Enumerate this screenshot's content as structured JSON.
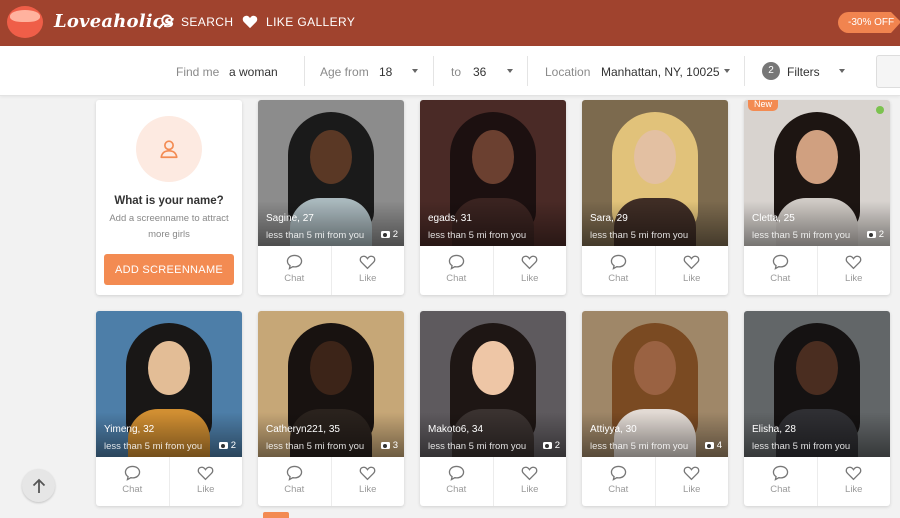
{
  "header": {
    "logo_text": "Loveaholics",
    "nav_search": "SEARCH",
    "nav_like_gallery": "LIKE GALLERY",
    "promo": "-30% OFF"
  },
  "filters": {
    "find_me_label": "Find me",
    "find_me_value": "a woman",
    "age_from_label": "Age from",
    "age_from_value": "18",
    "age_to_label": "to",
    "age_to_value": "36",
    "location_label": "Location",
    "location_value": "Manhattan, NY, 10025",
    "filters_count": "2",
    "filters_label": "Filters"
  },
  "prompt": {
    "title": "What is your name?",
    "subtitle": "Add a screenname to attract more girls",
    "button": "ADD SCREENNAME"
  },
  "action_labels": {
    "chat": "Chat",
    "like": "Like"
  },
  "profiles": [
    {
      "name": "Sagine, 27",
      "distance": "less than 5 mi from you",
      "photos": "2",
      "new": false,
      "online": false,
      "bg": "#8c8c8c",
      "hair": "#1a1a1a",
      "skin": "#5a3825",
      "top": "#a9b8bd"
    },
    {
      "name": "egads, 31",
      "distance": "less than 5 mi from you",
      "photos": "",
      "new": false,
      "online": false,
      "bg": "#4a2a26",
      "hair": "#1c1010",
      "skin": "#6b4030",
      "top": "#3a2320"
    },
    {
      "name": "Sara, 29",
      "distance": "less than 5 mi from you",
      "photos": "",
      "new": false,
      "online": false,
      "bg": "#7c6a4e",
      "hair": "#e1c27a",
      "skin": "#e3c0a2",
      "top": "#3f2d25"
    },
    {
      "name": "Cletta, 25",
      "distance": "less than 5 mi from you",
      "photos": "2",
      "new": true,
      "new_label": "New",
      "online": true,
      "bg": "#d8d3cf",
      "hair": "#1d1512",
      "skin": "#d0a080",
      "top": "#cfcac5"
    },
    {
      "name": "Yimeng, 32",
      "distance": "less than 5 mi from you",
      "photos": "2",
      "new": false,
      "online": false,
      "bg": "#4d7ea8",
      "hair": "#191716",
      "skin": "#e3bd96",
      "top": "#d18f32"
    },
    {
      "name": "Catheryn221, 35",
      "distance": "less than 5 mi from you",
      "photos": "3",
      "new": false,
      "online": false,
      "bg": "#c6a777",
      "hair": "#181210",
      "skin": "#3c2418",
      "top": "#2a221d"
    },
    {
      "name": "Makoto6, 34",
      "distance": "less than 5 mi from you",
      "photos": "2",
      "new": false,
      "online": false,
      "bg": "#5e5a5e",
      "hair": "#1e1614",
      "skin": "#eec6a6",
      "top": "#3a3230"
    },
    {
      "name": "Attiyya, 30",
      "distance": "less than 5 mi from you",
      "photos": "4",
      "new": false,
      "online": false,
      "bg": "#9f8768",
      "hair": "#7a4a22",
      "skin": "#9a6242",
      "top": "#e2dad4"
    },
    {
      "name": "Elisha, 28",
      "distance": "less than 5 mi from you",
      "photos": "",
      "new": false,
      "online": false,
      "bg": "#626668",
      "hair": "#151212",
      "skin": "#4a2d20",
      "top": "#2f2f33"
    }
  ]
}
